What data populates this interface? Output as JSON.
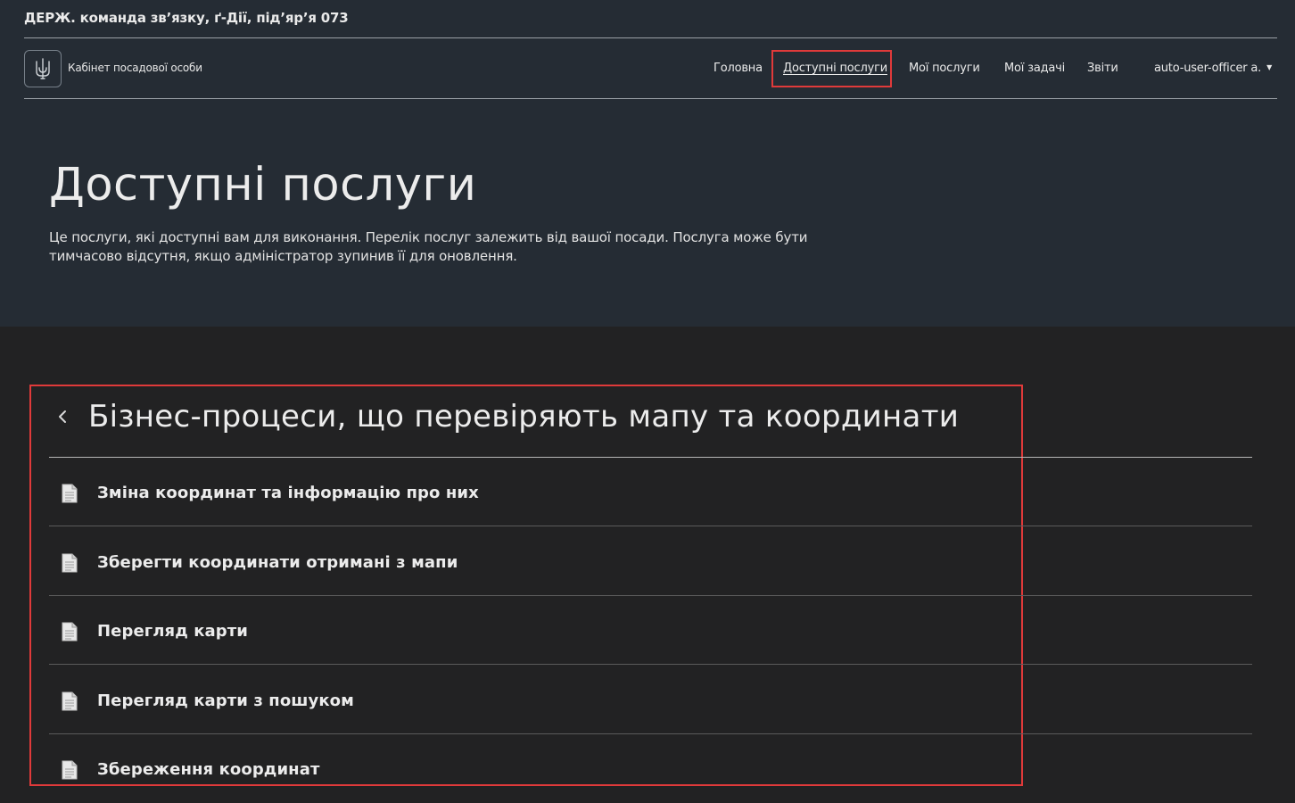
{
  "header": {
    "org_title": "ДЕРЖ. команда зв’язку, ґ-Дії, під’яр’я 073",
    "logo_text": "Кабінет посадової особи",
    "logo_icon": "trident-icon"
  },
  "nav": {
    "home": "Головна",
    "available_services": "Доступні послуги",
    "my_services": "Мої послуги",
    "my_tasks": "Мої задачі",
    "reports": "Звіти",
    "user": "auto-user-officer a."
  },
  "page": {
    "title": "Доступні послуги",
    "description": "Це послуги, які доступні вам для виконання. Перелік послуг залежить від вашої посади. Послуга може бути тимчасово відсутня, якщо адміністратор зупинив її для оновлення."
  },
  "section": {
    "title": "Бізнес-процеси, що перевіряють мапу та координати",
    "items": [
      {
        "label": "Зміна координат та інформацію про них"
      },
      {
        "label": "Зберегти координати отримані з мапи"
      },
      {
        "label": "Перегляд карти"
      },
      {
        "label": "Перегляд карти з пошуком"
      },
      {
        "label": "Збереження координат"
      }
    ]
  },
  "colors": {
    "header_bg": "#252c34",
    "page_bg": "#222223",
    "highlight": "#e03a3a",
    "text": "#ececec"
  }
}
